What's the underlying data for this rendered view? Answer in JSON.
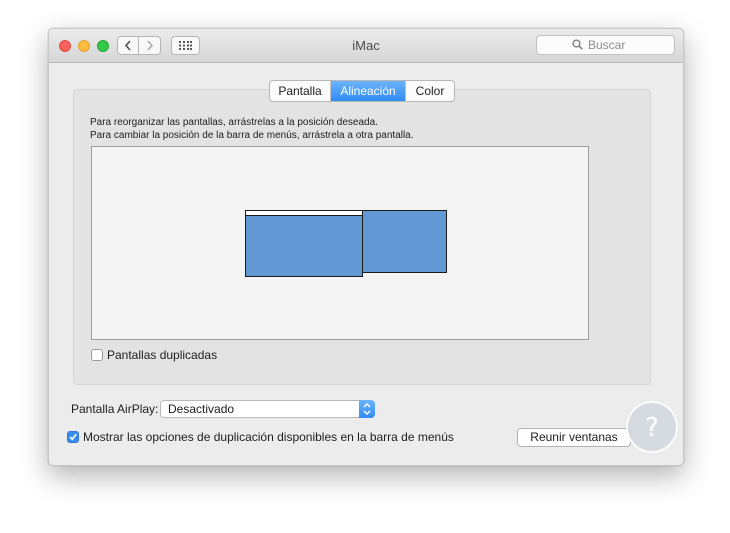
{
  "window": {
    "title": "iMac"
  },
  "toolbar": {
    "search_placeholder": "Buscar"
  },
  "tabs": [
    {
      "label": "Pantalla",
      "selected": false
    },
    {
      "label": "Alineación",
      "selected": true
    },
    {
      "label": "Color",
      "selected": false
    }
  ],
  "arrangement": {
    "instruction_line1": "Para reorganizar las pantallas, arrástrelas a la posición deseada.",
    "instruction_line2": "Para cambiar la posición de la barra de menús, arrástrela a otra pantalla.",
    "mirror_label": "Pantallas duplicadas",
    "mirror_checked": false
  },
  "airplay": {
    "label": "Pantalla AirPlay:",
    "value": "Desactivado"
  },
  "show_mirroring": {
    "label": "Mostrar las opciones de duplicación disponibles en la barra de menús",
    "checked": true
  },
  "gather_button": "Reunir ventanas",
  "colors": {
    "accent": "#2f8cf4",
    "display_fill": "#6299d5"
  },
  "watermark": {
    "glyph": "?"
  }
}
